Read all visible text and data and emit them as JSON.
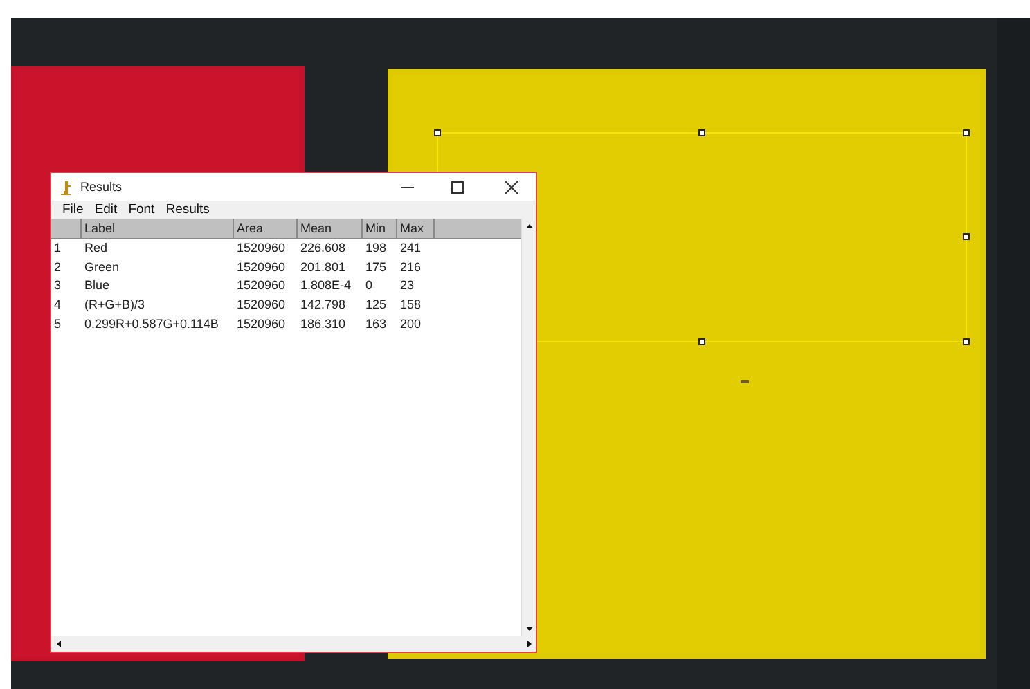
{
  "window": {
    "title": "Results"
  },
  "menu": [
    "File",
    "Edit",
    "Font",
    "Results"
  ],
  "table": {
    "columns": [
      "Label",
      "Area",
      "Mean",
      "Min",
      "Max"
    ],
    "rows": [
      {
        "index": "1",
        "cells": [
          "Red",
          "1520960",
          "226.608",
          "198",
          "241"
        ]
      },
      {
        "index": "2",
        "cells": [
          "Green",
          "1520960",
          "201.801",
          "175",
          "216"
        ]
      },
      {
        "index": "3",
        "cells": [
          "Blue",
          "1520960",
          "1.808E-4",
          "0",
          "23"
        ]
      },
      {
        "index": "4",
        "cells": [
          "(R+G+B)/3",
          "1520960",
          "142.798",
          "125",
          "158"
        ]
      },
      {
        "index": "5",
        "cells": [
          "0.299R+0.587G+0.114B",
          "1520960",
          "186.310",
          "163",
          "200"
        ]
      }
    ]
  }
}
